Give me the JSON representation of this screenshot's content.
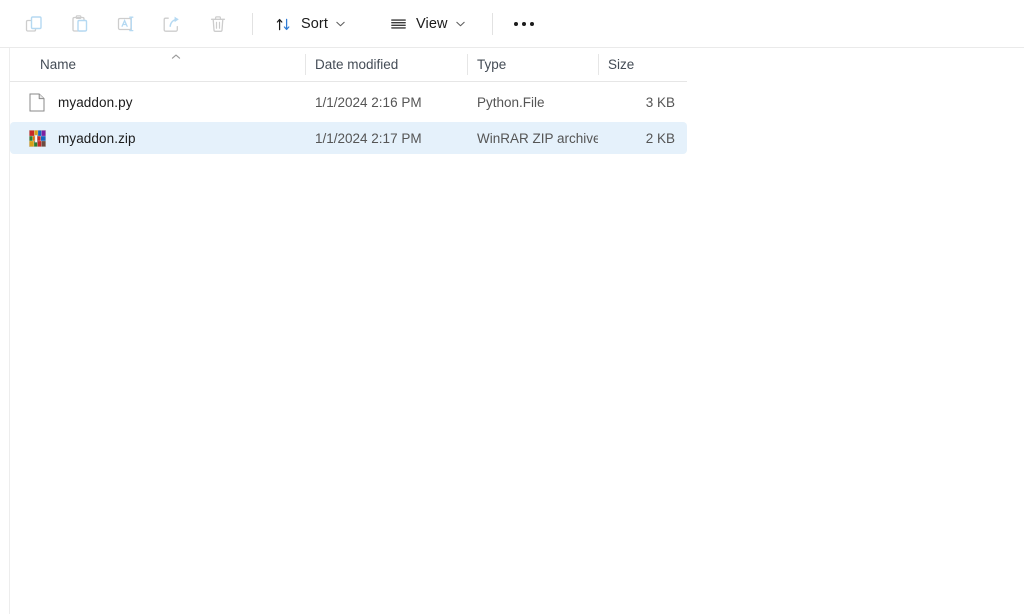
{
  "toolbar": {
    "buttons": [
      {
        "name": "copy-button",
        "icon": "copy-icon",
        "label": "Copy",
        "enabled": false
      },
      {
        "name": "paste-button",
        "icon": "paste-icon",
        "label": "Paste",
        "enabled": false
      },
      {
        "name": "rename-button",
        "icon": "rename-icon",
        "label": "Rename",
        "enabled": false
      },
      {
        "name": "share-button",
        "icon": "share-icon",
        "label": "Share",
        "enabled": false
      },
      {
        "name": "delete-button",
        "icon": "delete-icon",
        "label": "Delete",
        "enabled": false
      }
    ],
    "sort": {
      "label": "Sort",
      "icon": "sort-arrows-icon",
      "chevron": "chevron-down-icon"
    },
    "view": {
      "label": "View",
      "icon": "view-list-icon",
      "chevron": "chevron-down-icon"
    },
    "more": {
      "label": "See more",
      "icon": "ellipsis-icon"
    }
  },
  "columns": {
    "name": "Name",
    "date_modified": "Date modified",
    "type": "Type",
    "size": "Size",
    "sort_column": "Name",
    "sort_direction": "ascending",
    "sort_indicator_icon": "chevron-up-icon"
  },
  "files": [
    {
      "name": "myaddon.py",
      "date_modified": "1/1/2024 2:16 PM",
      "type": "Python.File",
      "size": "3 KB",
      "icon": "generic-file-icon",
      "selected": false
    },
    {
      "name": "myaddon.zip",
      "date_modified": "1/1/2024 2:17 PM",
      "type": "WinRAR ZIP archive",
      "size": "2 KB",
      "icon": "winrar-archive-icon",
      "selected": true
    }
  ],
  "colors": {
    "selection": "#e5f1fb",
    "header_text": "#444c56",
    "body_text": "#1b1b1b",
    "disabled_icon": "#c8c8c8",
    "accent_icon": "#b5d9f2",
    "divider": "#e6e6e6"
  }
}
